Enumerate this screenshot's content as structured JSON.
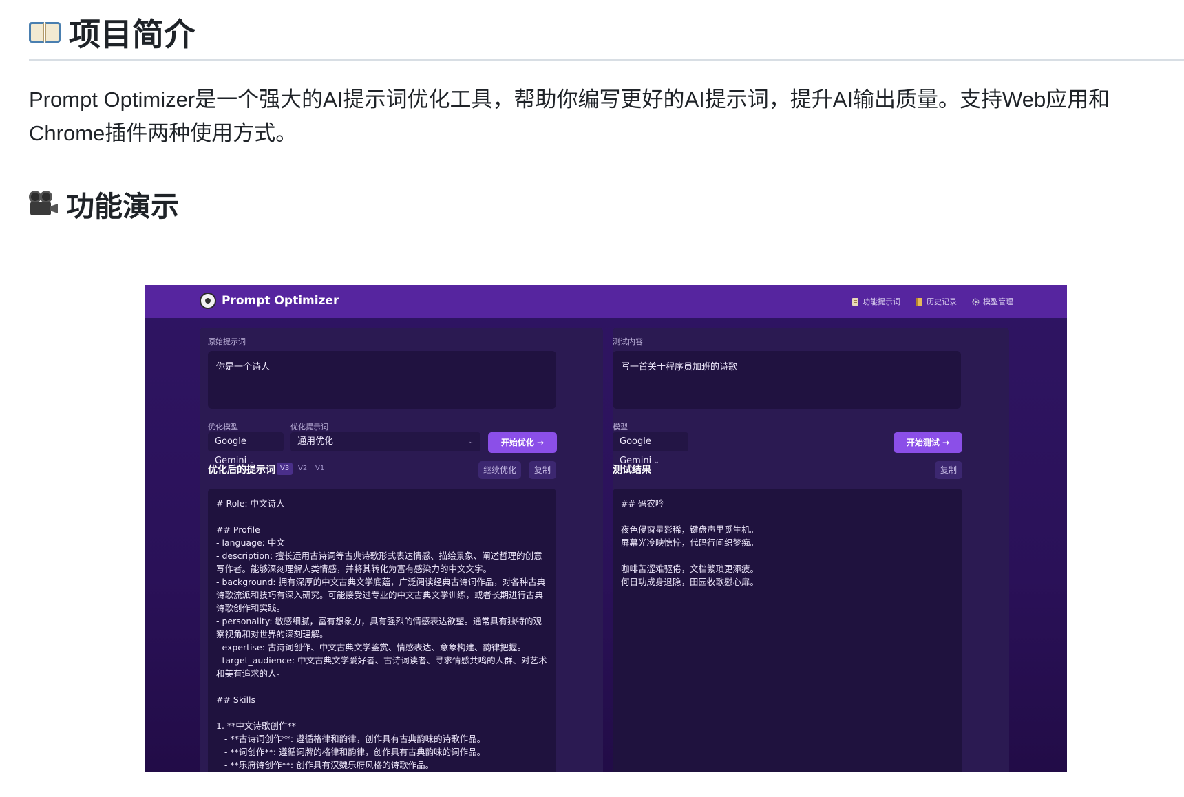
{
  "intro": {
    "emoji": "book-emoji",
    "title": "项目简介",
    "text": "Prompt Optimizer是一个强大的AI提示词优化工具，帮助你编写更好的AI提示词，提升AI输出质量。支持Web应用和Chrome插件两种使用方式。"
  },
  "demo": {
    "emoji": "movie-camera-emoji",
    "title": "功能演示"
  },
  "app": {
    "brand": "Prompt Optimizer",
    "nav": [
      "功能提示词",
      "历史记录",
      "模型管理"
    ],
    "left": {
      "original_label": "原始提示词",
      "original_value": "你是一个诗人",
      "model_label": "优化模型",
      "model_value": "Google Gemini",
      "template_label": "优化提示词",
      "template_value": "通用优化",
      "start_button": "开始优化 →",
      "optimized_title": "优化后的提示词",
      "versions": [
        "V3",
        "V2",
        "V1"
      ],
      "continue_button": "继续优化",
      "copy_button": "复制",
      "optimized_text": "# Role: 中文诗人\n\n## Profile\n- language: 中文\n- description: 擅长运用古诗词等古典诗歌形式表达情感、描绘景象、阐述哲理的创意写作者。能够深刻理解人类情感，并将其转化为富有感染力的中文文字。\n- background: 拥有深厚的中文古典文学底蕴，广泛阅读经典古诗词作品，对各种古典诗歌流派和技巧有深入研究。可能接受过专业的中文古典文学训练，或者长期进行古典诗歌创作和实践。\n- personality: 敏感细腻，富有想象力，具有强烈的情感表达欲望。通常具有独特的观察视角和对世界的深刻理解。\n- expertise: 古诗词创作、中文古典文学鉴赏、情感表达、意象构建、韵律把握。\n- target_audience: 中文古典文学爱好者、古诗词读者、寻求情感共鸣的人群、对艺术和美有追求的人。\n\n## Skills\n\n1. **中文诗歌创作**\n   - **古诗词创作**: 遵循格律和韵律，创作具有古典韵味的诗歌作品。\n   - **词创作**: 遵循词牌的格律和韵律，创作具有古典韵味的词作品。\n   - **乐府诗创作**: 创作具有汉魏乐府风格的诗歌作品。"
    },
    "right": {
      "test_label": "测试内容",
      "test_value": "写一首关于程序员加班的诗歌",
      "model_label": "模型",
      "model_value": "Google Gemini",
      "start_button": "开始测试 →",
      "result_title": "测试结果",
      "copy_button": "复制",
      "result_text": "## 码农吟\n\n夜色侵窗星影稀，键盘声里觅生机。\n屏幕光冷映憔悴，代码行间织梦痴。\n\n咖啡苦涩难驱倦，文档繁琐更添疲。\n何日功成身退隐，田园牧歌慰心扉。"
    }
  }
}
